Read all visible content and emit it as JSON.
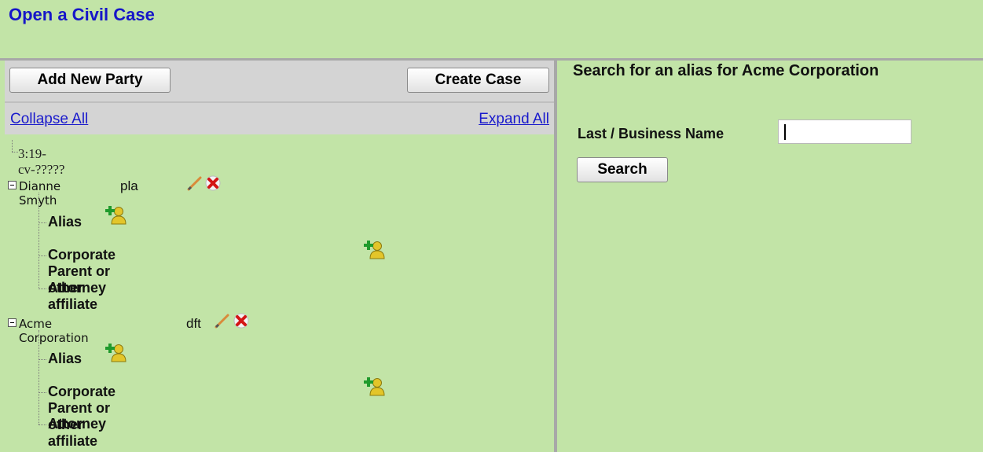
{
  "page": {
    "title": "Open a Civil Case"
  },
  "toolbar": {
    "add_party_label": "Add New Party",
    "create_case_label": "Create Case",
    "collapse_label": "Collapse All",
    "expand_label": "Expand All"
  },
  "tree": {
    "case_number": "3:19-cv-?????",
    "parties": [
      {
        "name": "Dianne Smyth",
        "role": "pla",
        "children": [
          {
            "label": "Alias"
          },
          {
            "label": "Corporate Parent or other affiliate"
          },
          {
            "label": "Attorney"
          }
        ]
      },
      {
        "name": "Acme Corporation",
        "role": "dft",
        "children": [
          {
            "label": "Alias"
          },
          {
            "label": "Corporate Parent or other affiliate"
          },
          {
            "label": "Attorney"
          }
        ]
      }
    ]
  },
  "search": {
    "heading": "Search for an alias for Acme Corporation",
    "field_label": "Last / Business Name",
    "field_value": "",
    "button_label": "Search"
  },
  "icons": {
    "edit": "pencil-icon",
    "delete": "delete-x-icon",
    "add": "add-person-icon"
  },
  "colors": {
    "background": "#c2e4a7",
    "title": "#1616c8",
    "link": "#1a1acc",
    "toolbar": "#d4d4d4"
  }
}
